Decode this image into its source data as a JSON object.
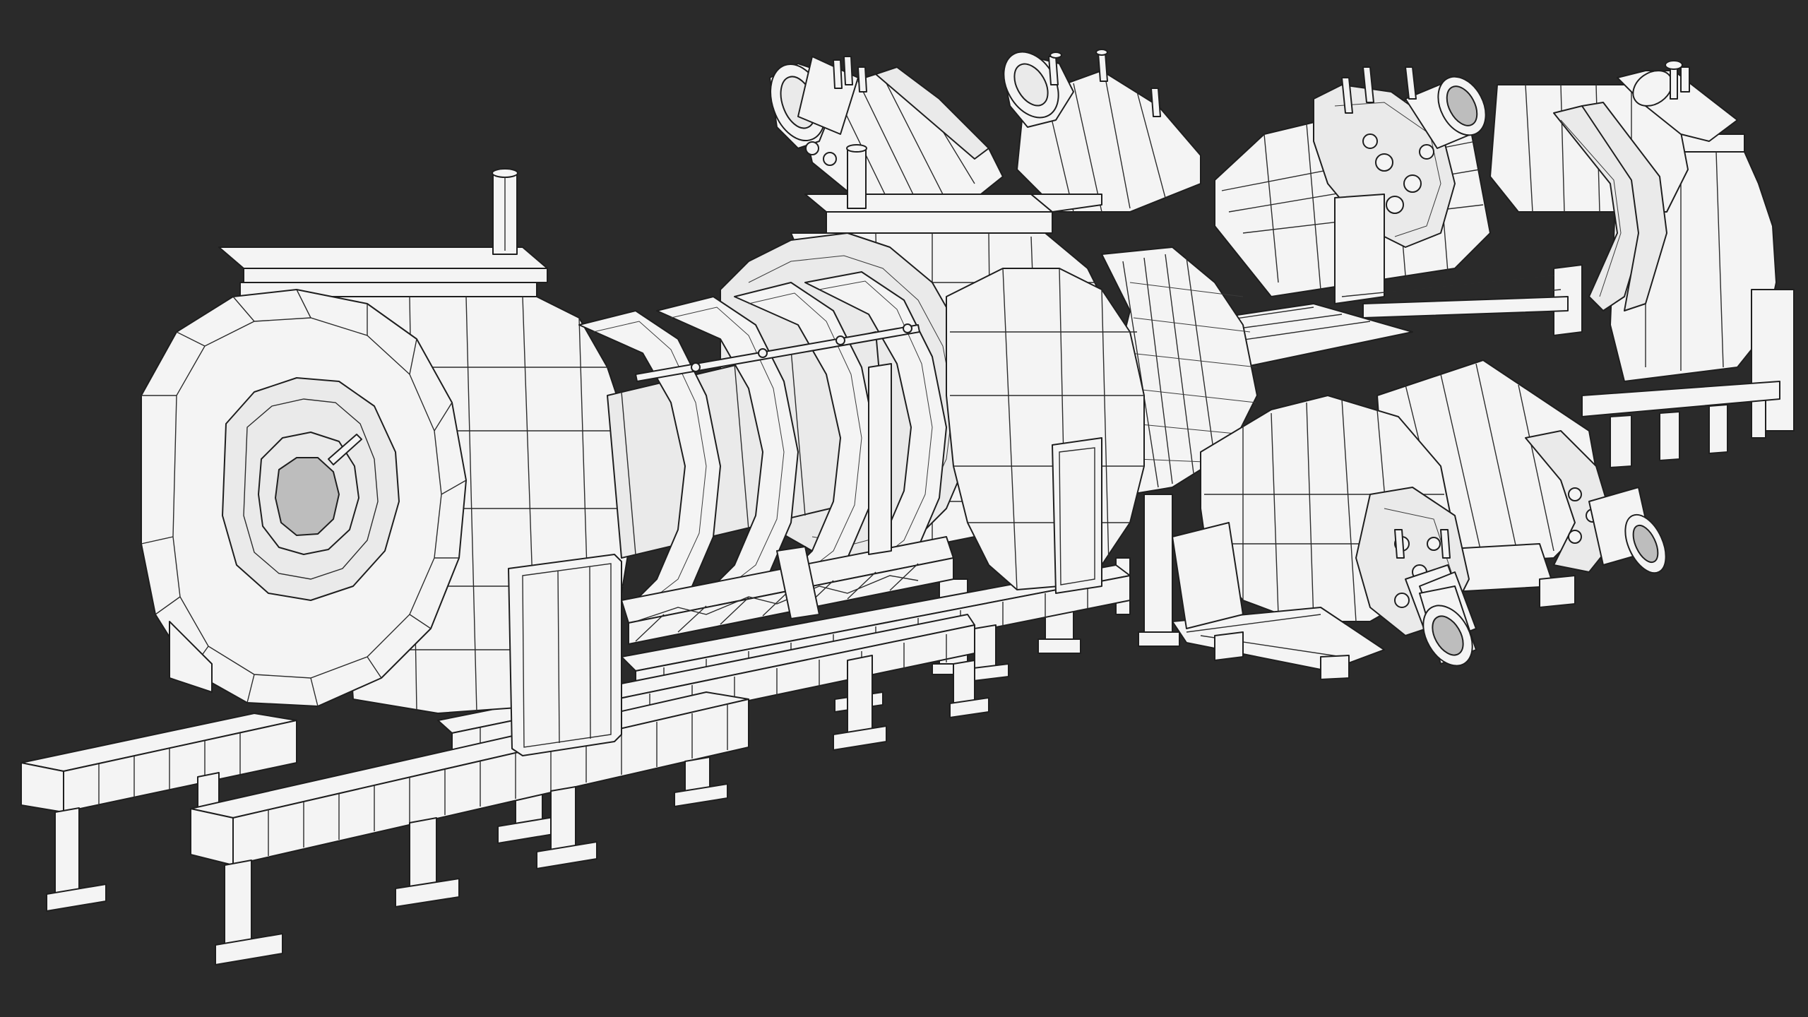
{
  "scene": {
    "subject": "wireframe-3d-model",
    "background_color": "#2a2a2a",
    "model_fill_color": "#f4f4f4",
    "wire_color": "#1e1e1e"
  }
}
